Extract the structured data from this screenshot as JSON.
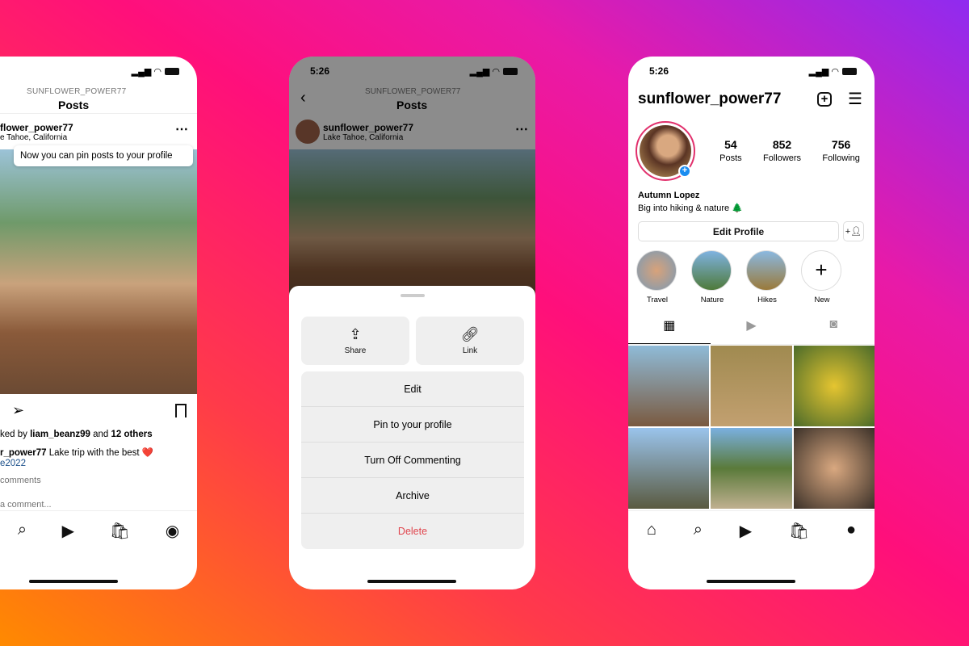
{
  "status_time": "5:26",
  "left": {
    "header_sub": "SUNFLOWER_POWER77",
    "header_title": "Posts",
    "username": "flower_power77",
    "location": "e Tahoe, California",
    "tooltip": "Now you can pin posts to your profile",
    "likes_prefix": "ked by ",
    "likes_user": "liam_beanz99",
    "likes_mid": " and ",
    "likes_count": "12 others",
    "caption_user": "r_power77",
    "caption_text": " Lake trip with the best ❤️",
    "hashtag": "e2022",
    "comments": "comments",
    "add_comment": "a comment..."
  },
  "middle": {
    "header_sub": "SUNFLOWER_POWER77",
    "header_title": "Posts",
    "username": "sunflower_power77",
    "location": "Lake Tahoe, California",
    "share": "Share",
    "link": "Link",
    "menu": [
      "Edit",
      "Pin to your profile",
      "Turn Off Commenting",
      "Archive",
      "Delete"
    ],
    "delete_color": "#e0464e"
  },
  "right": {
    "username": "sunflower_power77",
    "stats": [
      {
        "value": "54",
        "label": "Posts"
      },
      {
        "value": "852",
        "label": "Followers"
      },
      {
        "value": "756",
        "label": "Following"
      }
    ],
    "name": "Autumn Lopez",
    "bio": "Big into hiking & nature 🌲",
    "edit_profile": "Edit Profile",
    "highlights": [
      "Travel",
      "Nature",
      "Hikes",
      "New"
    ]
  }
}
